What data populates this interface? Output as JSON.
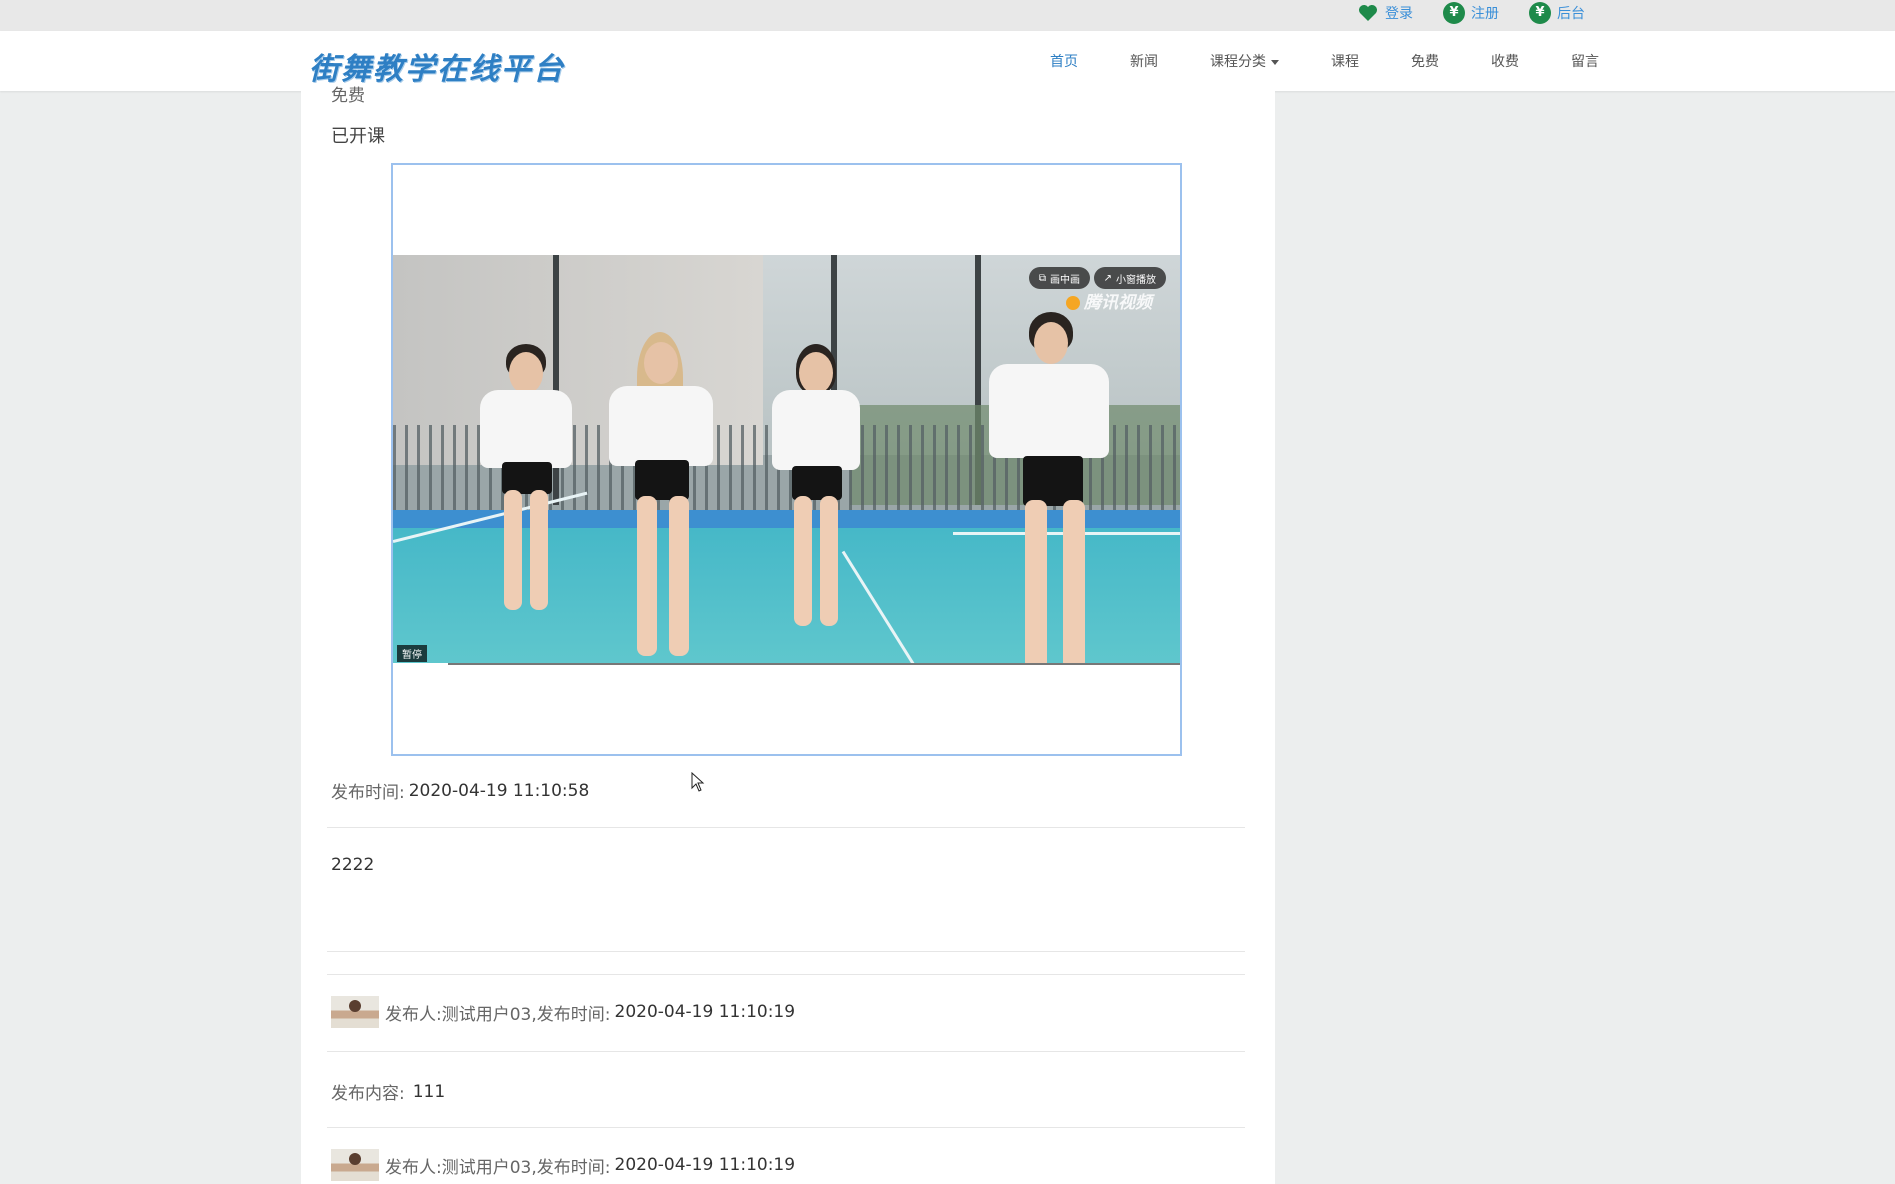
{
  "header": {
    "top_links": [
      {
        "icon": "heart-icon",
        "label": "登录"
      },
      {
        "icon": "yen-icon",
        "label": "注册"
      },
      {
        "icon": "yen-icon",
        "label": "后台"
      }
    ],
    "brand": "街舞教学在线平台",
    "nav": [
      {
        "label": "首页",
        "active": true
      },
      {
        "label": "新闻"
      },
      {
        "label": "课程分类"
      },
      {
        "label": "课程"
      },
      {
        "label": "免费"
      },
      {
        "label": "收费"
      },
      {
        "label": "留言"
      }
    ]
  },
  "main": {
    "clipped_label": "免费",
    "status": "已开课",
    "video": {
      "btn_pip": "画中画",
      "btn_mini": "小窗播放",
      "watermark": "腾讯视频",
      "pause_label": "暂停",
      "progress": 0.07
    },
    "publish_label": "发布时间:",
    "publish_time": "2020-04-19 11:10:58",
    "body_text": "2222",
    "comments": [
      {
        "author_label": "发布人:",
        "author": "测试用户03",
        "time_label": ",发布时间:",
        "time": "2020-04-19 11:10:19",
        "content_label": "发布内容:",
        "content": "111"
      },
      {
        "author_label": "发布人:",
        "author": "测试用户03",
        "time_label": ",发布时间:",
        "time": "2020-04-19 11:10:19"
      }
    ]
  }
}
